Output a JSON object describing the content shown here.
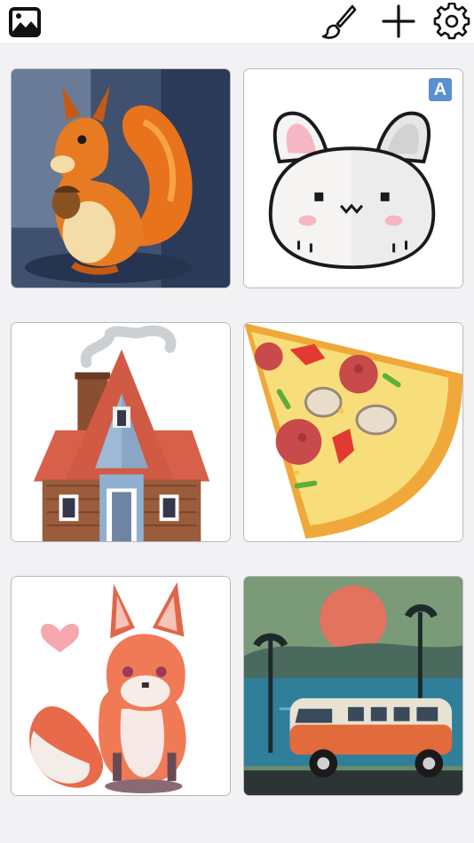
{
  "toolbar": {
    "icons": [
      "gallery-icon",
      "brush-icon",
      "plus-icon",
      "gear-icon"
    ]
  },
  "gallery": {
    "items": [
      {
        "subject": "squirrel"
      },
      {
        "subject": "bunny",
        "badge": "A"
      },
      {
        "subject": "house"
      },
      {
        "subject": "pizza"
      },
      {
        "subject": "fox"
      },
      {
        "subject": "van"
      }
    ]
  },
  "colors": {
    "background": "#f2f2f4",
    "topbar": "#ffffff",
    "card_border": "#b8b8bc",
    "badge": "#5a8fd2"
  }
}
